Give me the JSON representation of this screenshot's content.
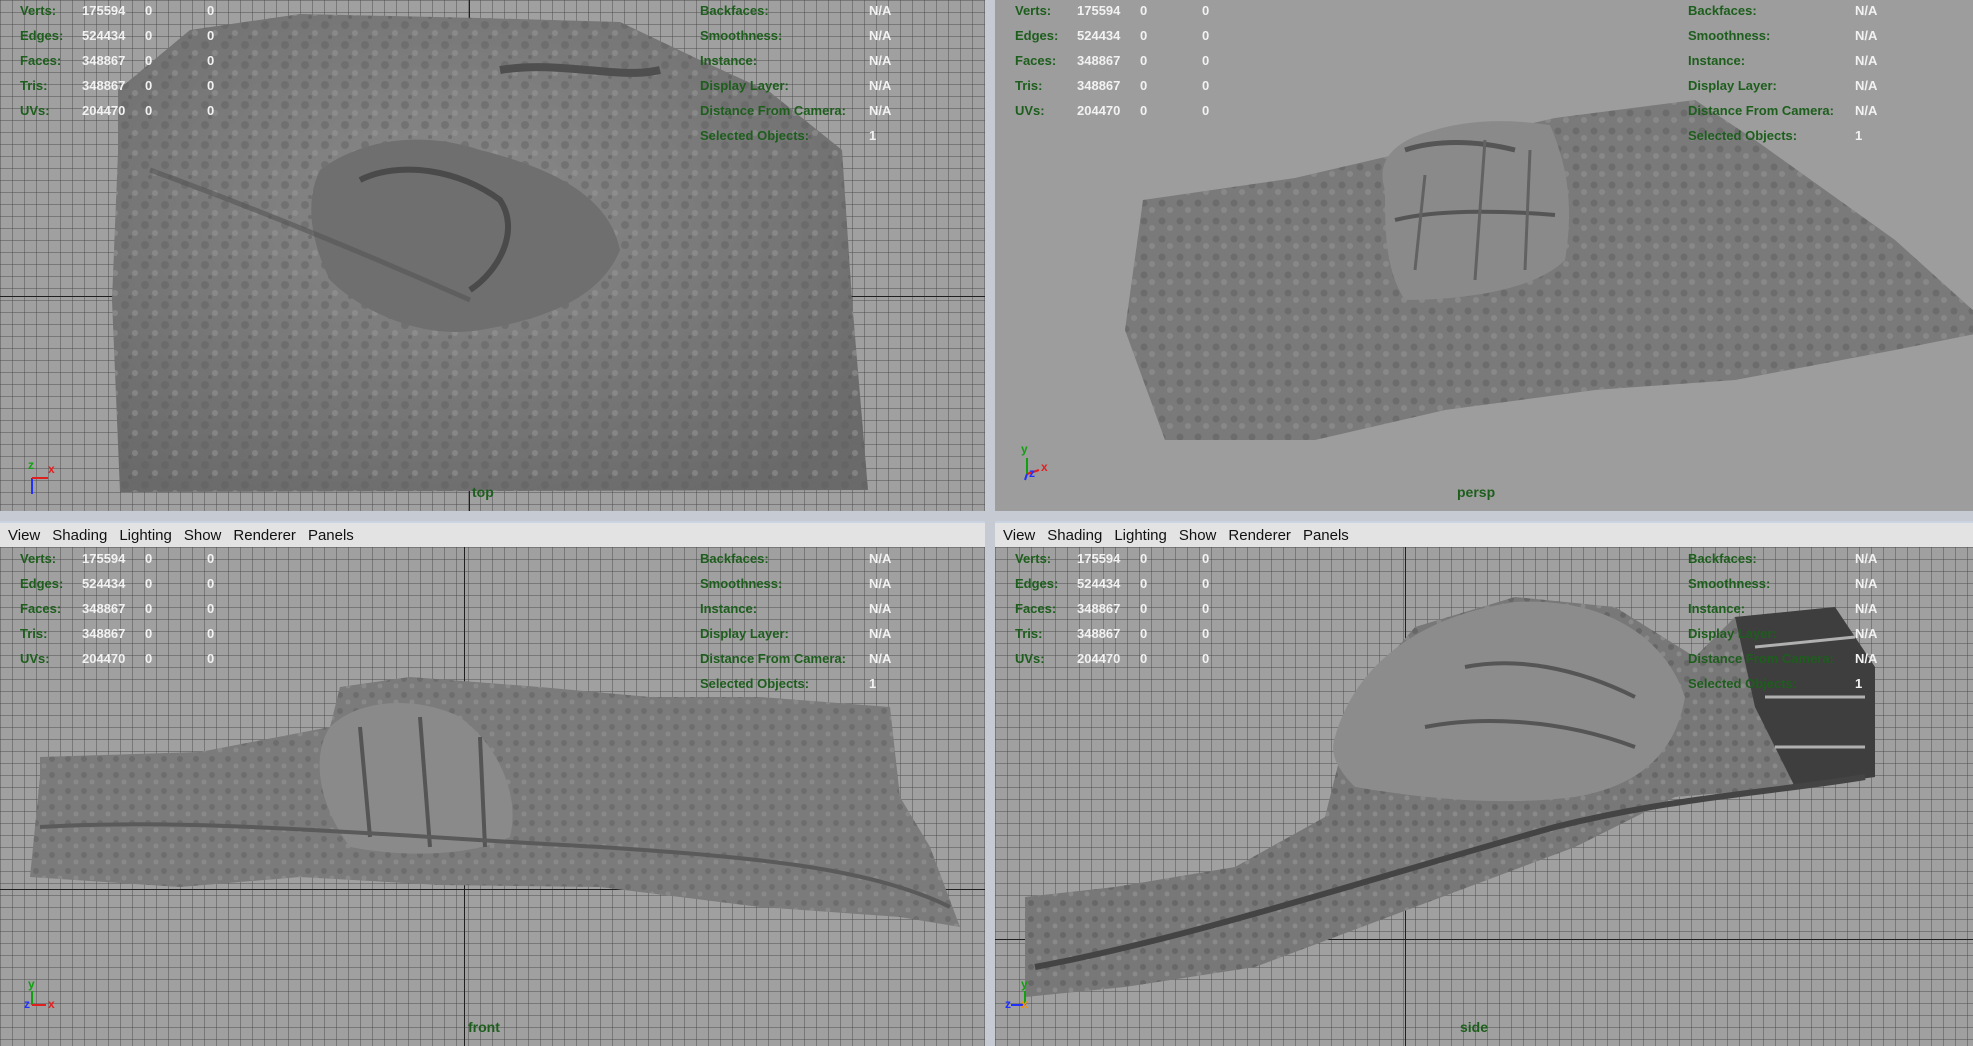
{
  "menu": [
    "View",
    "Shading",
    "Lighting",
    "Show",
    "Renderer",
    "Panels"
  ],
  "hud": {
    "verts": {
      "label": "Verts:",
      "v1": "175594",
      "v2": "0",
      "v3": "0"
    },
    "edges": {
      "label": "Edges:",
      "v1": "524434",
      "v2": "0",
      "v3": "0"
    },
    "faces": {
      "label": "Faces:",
      "v1": "348867",
      "v2": "0",
      "v3": "0"
    },
    "tris": {
      "label": "Tris:",
      "v1": "348867",
      "v2": "0",
      "v3": "0"
    },
    "uvs": {
      "label": "UVs:",
      "v1": "204470",
      "v2": "0",
      "v3": "0"
    },
    "backfaces": {
      "label": "Backfaces:",
      "value": "N/A"
    },
    "smoothness": {
      "label": "Smoothness:",
      "value": "N/A"
    },
    "instance": {
      "label": "Instance:",
      "value": "N/A"
    },
    "display_layer": {
      "label": "Display Layer:",
      "value": "N/A"
    },
    "distance": {
      "label": "Distance From Camera:",
      "value": "N/A"
    },
    "selected": {
      "label": "Selected Objects:",
      "value": "1"
    }
  },
  "viewports": {
    "top": "top",
    "persp": "persp",
    "front": "front",
    "side": "side"
  },
  "axes": {
    "x": "x",
    "y": "y",
    "z": "z"
  },
  "colors": {
    "hud_label": "#1d5e1d",
    "hud_value": "#f2f2f2",
    "viewport_bg": "#a0a0a0",
    "menubar_bg": "#e3e3e3"
  }
}
